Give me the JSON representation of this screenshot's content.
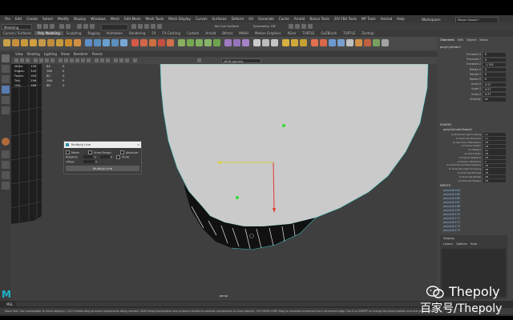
{
  "menubar": {
    "items": [
      "File",
      "Edit",
      "Create",
      "Select",
      "Modify",
      "Display",
      "Windows",
      "Mesh",
      "Edit Mesh",
      "Mesh Tools",
      "Mesh Display",
      "Curves",
      "Surfaces",
      "Deform",
      "UV",
      "Generate",
      "Cache",
      "Arnold",
      "Bonus Tools",
      "ZIV FBX Tools",
      "MF Tools",
      "Animal",
      "Help"
    ],
    "workspace_label": "Workspace:",
    "workspace_value": "Maya Classic*"
  },
  "statusline": {
    "mode": "Modeling",
    "no_live_surface": "No Live Surface",
    "symmetry": "Symmetry: Off"
  },
  "shelf": {
    "tabs": [
      "Curves / Surfaces",
      "Poly Modeling",
      "Sculpting",
      "Rigging",
      "Animation",
      "Rendering",
      "FX",
      "FX Caching",
      "Custom",
      "Arnold",
      "Bifrost",
      "MASH",
      "Motion Graphics",
      "XGen",
      "TURTLE",
      "GoZBrush",
      "TURTLE",
      "Zivdrop"
    ],
    "active_tab": "Poly Modeling"
  },
  "viewport": {
    "menu": [
      "View",
      "Shading",
      "Lighting",
      "Show",
      "Renderer",
      "Panels"
    ],
    "colorspace": "sRGB gamma",
    "camera_label": "persp",
    "hud": {
      "rows": [
        {
          "label": "Verts:",
          "a": "156",
          "b": "84",
          "c": "0"
        },
        {
          "label": "Edges:",
          "a": "340",
          "b": "165",
          "c": "0"
        },
        {
          "label": "Faces:",
          "a": "184",
          "b": "82",
          "c": "0"
        },
        {
          "label": "Tris:",
          "a": "296",
          "b": "164",
          "c": "0"
        },
        {
          "label": "UVs:",
          "a": "186",
          "b": "88",
          "c": "0"
        }
      ]
    }
  },
  "dialog": {
    "title": "Multiply Line",
    "row1": [
      "Mode",
      "Snap Range",
      "Absolute"
    ],
    "row2_label": "Rotation",
    "row2_values": [
      "0",
      "0",
      "Multi"
    ],
    "row3_label": "Offset",
    "row3_value": "0",
    "button": "Multiply Line"
  },
  "channelbox": {
    "tabs": [
      "Channels",
      "Edit",
      "Object",
      "Show"
    ],
    "object_name": "polyCylinder1",
    "attributes": [
      {
        "name": "Translate X",
        "value": "0"
      },
      {
        "name": "Translate Y",
        "value": "0"
      },
      {
        "name": "Translate Z",
        "value": "-1.793"
      },
      {
        "name": "Rotate X",
        "value": "0"
      },
      {
        "name": "Rotate Y",
        "value": "0"
      },
      {
        "name": "Rotate Z",
        "value": "0"
      },
      {
        "name": "Scale X",
        "value": "0.57"
      },
      {
        "name": "Scale Y",
        "value": "0.57"
      },
      {
        "name": "Scale Z",
        "value": "0.57"
      },
      {
        "name": "Visibility",
        "value": "on"
      }
    ],
    "shapes_header": "SHAPES",
    "shape_name": "polyCylinderShape1",
    "shape_attrs": [
      {
        "name": "Ai Override Light Linking",
        "value": "on"
      },
      {
        "name": "Ai Override Shadows",
        "value": "on"
      },
      {
        "name": "Ai Use Color Estimation",
        "value": "off"
      },
      {
        "name": "Ai Frame Subdiv",
        "value": "off"
      },
      {
        "name": "Ai Opaque",
        "value": "on"
      },
      {
        "name": "Ai Use Subdiv",
        "value": "off"
      },
      {
        "name": "Ai Export Displace",
        "value": "off"
      },
      {
        "name": "Ai Subdiv Iterations",
        "value": "1"
      },
      {
        "name": "Ai Override Sample Displace",
        "value": "off"
      },
      {
        "name": "Ai Override Light Grouping",
        "value": "off"
      },
      {
        "name": "Ai Override SSS Set",
        "value": "off"
      },
      {
        "name": "Ai Override Nodes",
        "value": "off"
      },
      {
        "name": "Ai Override Shaper",
        "value": "off"
      }
    ],
    "inputs_header": "INPUTS",
    "inputs": [
      "polySplit164",
      "polySplit165",
      "polySplit166",
      "polySplit167",
      "polySplit168",
      "polySplit169",
      "polySplit170",
      "polySplit171",
      "polySplit172",
      "polySplit173",
      "polySplit174"
    ]
  },
  "display_panel": {
    "title": "Display",
    "tabs": [
      "Layers",
      "Options",
      "Help"
    ]
  },
  "command": {
    "label": "MEL",
    "help": "Move Tool: Use manipulator to move object(s). Ctrl+middle-drag to move components along normals. Shift+drag manipulator axis or plane handles to extrude components or clone objects. Ctrl+Shift+LMB+drag to constrain movement to a connected edge. Use D or INSERT to change the pivot position and axis orientation."
  },
  "watermark": {
    "line1": "Thepoly",
    "line2": "百家号/Thepoly"
  },
  "colors": {
    "panel": "#444444",
    "mesh": "#cacaca",
    "axis_x": "#e03a2e",
    "axis_y": "#d8d13a",
    "handle": "#3ad83a",
    "maya_cyan": "#20b3c9"
  }
}
